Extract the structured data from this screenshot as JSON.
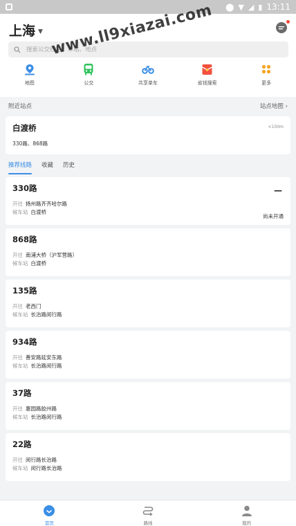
{
  "status_bar": {
    "time": "13:11"
  },
  "header": {
    "city": "上海",
    "search_placeholder": "搜索公交线路、车站、地点"
  },
  "shortcuts": [
    {
      "label": "地图",
      "icon": "map-pin-icon",
      "color": "#3a8ee6"
    },
    {
      "label": "公交",
      "icon": "bus-icon",
      "color": "#2ec25b"
    },
    {
      "label": "共享单车",
      "icon": "bicycle-icon",
      "color": "#3a8ee6"
    },
    {
      "label": "省钱搜索",
      "icon": "red-envelope-icon",
      "color": "#f2523f"
    },
    {
      "label": "更多",
      "icon": "grid-icon",
      "color": "#f5a623"
    }
  ],
  "nearby": {
    "title": "附近站点",
    "map_link": "站点地图 ›",
    "stop_name": "白渡桥",
    "distance": "<100m",
    "lines": "330路、868路"
  },
  "tabs": [
    "推荐线路",
    "收藏",
    "历史"
  ],
  "routes": [
    {
      "name": "330路",
      "direction_label": "开往",
      "direction": "扬州路齐齐哈尔路",
      "stop_label": "候车站",
      "stop": "白渡桥",
      "dash": "—",
      "status": "尚未开通"
    },
    {
      "name": "868路",
      "direction_label": "开往",
      "direction": "南浦大桥（沪军营路）",
      "stop_label": "候车站",
      "stop": "白渡桥"
    },
    {
      "name": "135路",
      "direction_label": "开往",
      "direction": "老西门",
      "stop_label": "候车站",
      "stop": "长治路闵行路"
    },
    {
      "name": "934路",
      "direction_label": "开往",
      "direction": "善安路延安东路",
      "stop_label": "候车站",
      "stop": "长治路闵行路"
    },
    {
      "name": "37路",
      "direction_label": "开往",
      "direction": "惠园路胶州路",
      "stop_label": "候车站",
      "stop": "长治路闵行路"
    },
    {
      "name": "22路",
      "direction_label": "开往",
      "direction": "闵行路长治路",
      "stop_label": "候车站",
      "stop": "闵行路长治路"
    }
  ],
  "bottom_nav": [
    {
      "label": "首页",
      "icon": "home-icon"
    },
    {
      "label": "路线",
      "icon": "route-icon"
    },
    {
      "label": "我的",
      "icon": "person-icon"
    }
  ],
  "watermark": "www.ll9xiazai.com",
  "colors": {
    "accent": "#3a8ee6",
    "background": "#f2f3f5"
  }
}
